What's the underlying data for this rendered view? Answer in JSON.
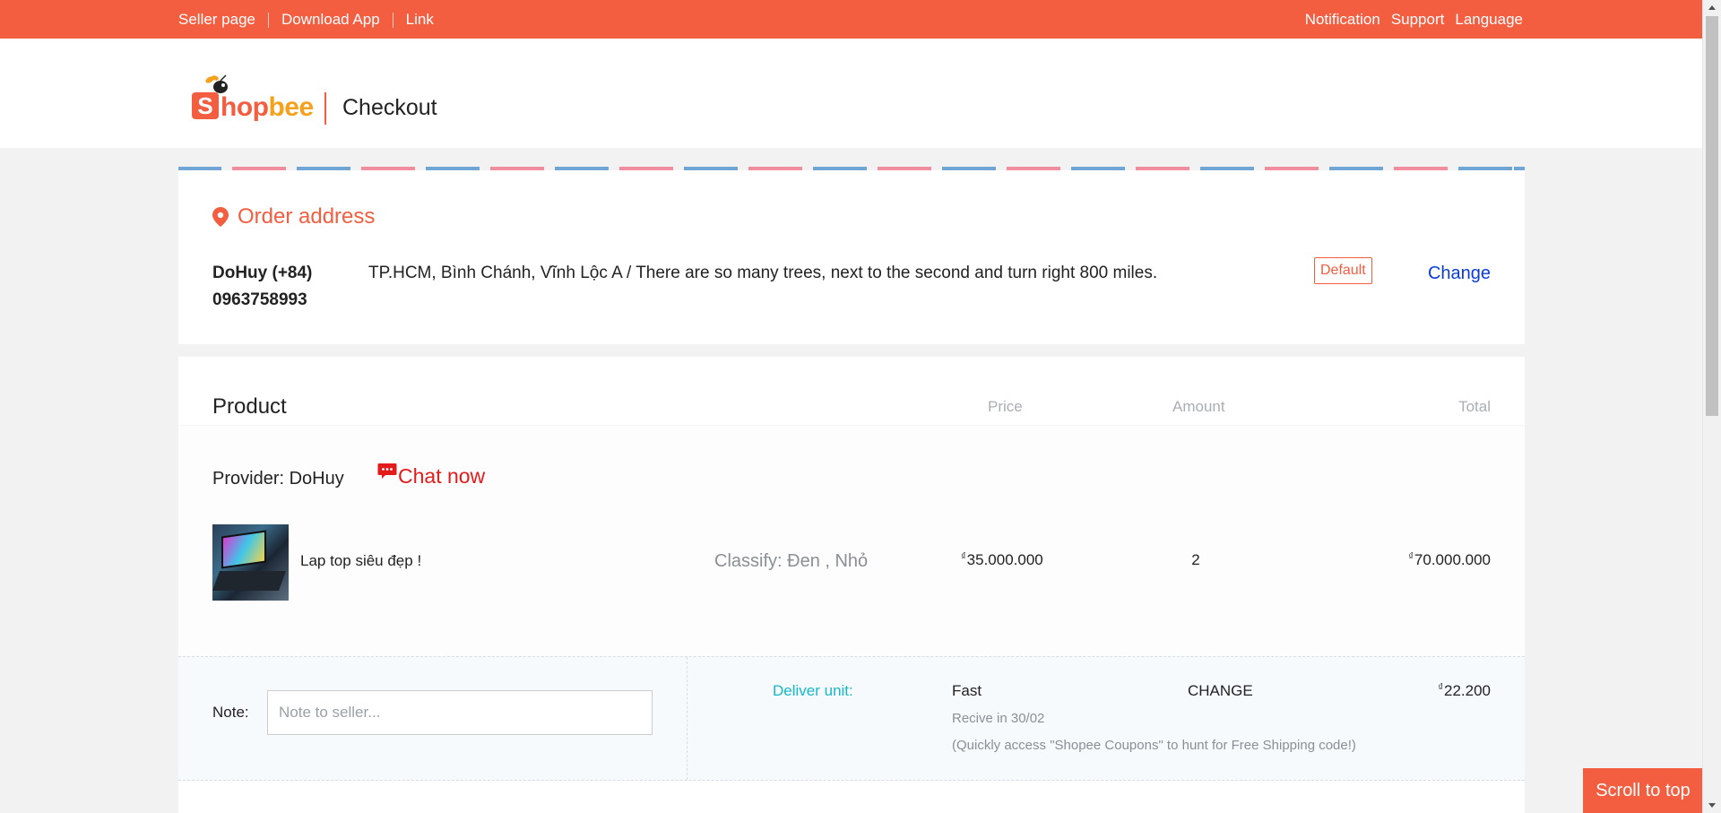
{
  "topbar": {
    "left_links": [
      "Seller page",
      "Download App",
      "Link"
    ],
    "right_links": [
      "Notification",
      "Support",
      "Language"
    ]
  },
  "header": {
    "logo_text_s": "S",
    "logo_text_hop": "hop",
    "logo_text_bee": "bee",
    "page_title": "Checkout"
  },
  "address": {
    "heading": "Order address",
    "name": "DoHuy (+84) 0963758993",
    "line": "TP.HCM, Bình Chánh, Vĩnh Lộc A / There are so many trees, next to the second and turn right 800 miles.",
    "badge": "Default",
    "change_label": "Change"
  },
  "product": {
    "title": "Product",
    "columns": {
      "price": "Price",
      "amount": "Amount",
      "total": "Total"
    },
    "provider": "Provider: DoHuy",
    "chat_label": "Chat now",
    "item": {
      "name": "Lap top siêu đẹp !",
      "classify": "Classify: Đen , Nhỏ",
      "currency": "₫",
      "price": "35.000.000",
      "amount": "2",
      "total": "70.000.000"
    },
    "shipping": {
      "note_label": "Note:",
      "note_placeholder": "Note to seller...",
      "deliver_label": "Deliver unit:",
      "deliver_method": "Fast",
      "change_label": "CHANGE",
      "fee": "22.200",
      "receive": "Recive in 30/02",
      "coupon_hint": "(Quickly access \"Shopee Coupons\" to hunt for Free Shipping code!)"
    }
  },
  "scroll_top_label": "Scroll to top",
  "colors": {
    "brand": "#f35d40",
    "accent_cyan": "#16b8c8",
    "link_blue": "#0b3bd8",
    "chat_red": "#e31b1b"
  },
  "icons": [
    "location-pin-icon",
    "chat-bubble-icon",
    "bee-icon"
  ]
}
